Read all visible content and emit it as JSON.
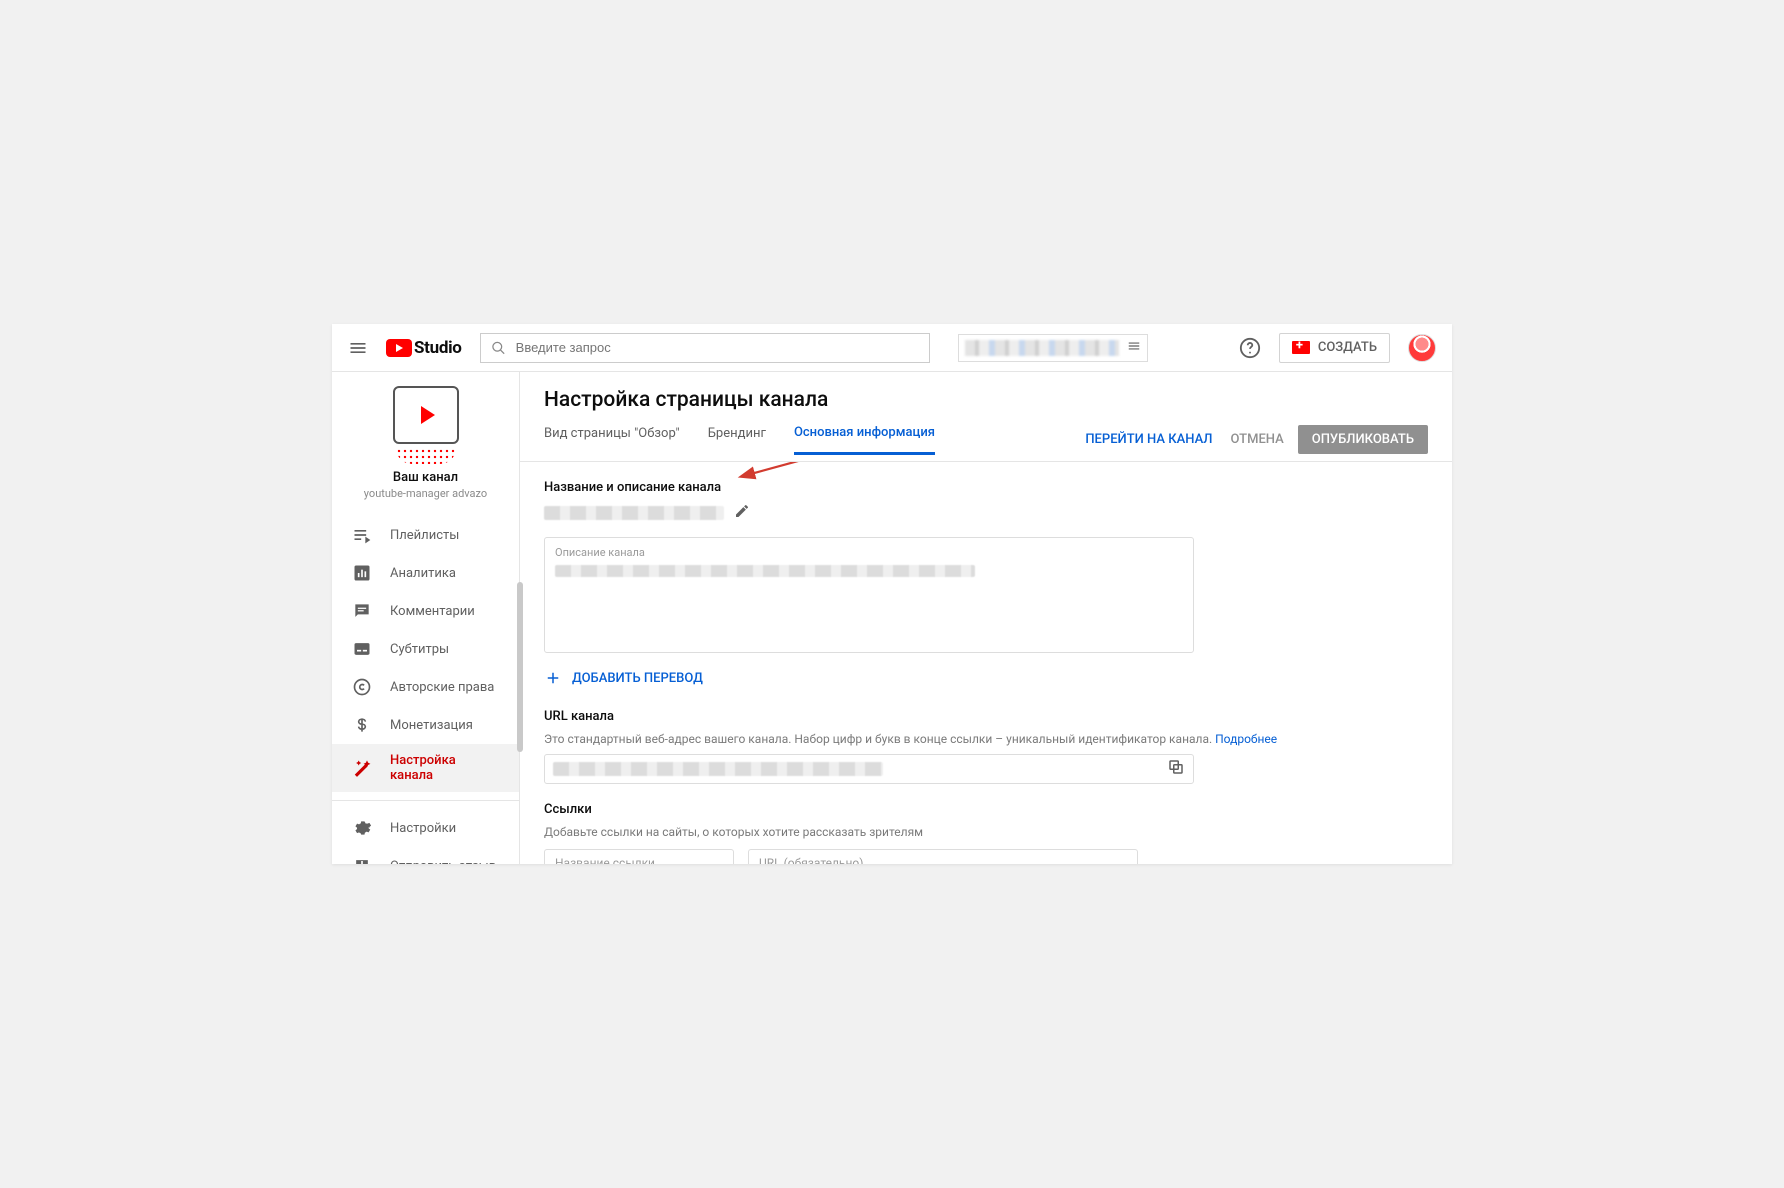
{
  "header": {
    "logo_text": "Studio",
    "search_placeholder": "Введите запрос",
    "create_label": "СОЗДАТЬ"
  },
  "sidebar": {
    "channel_title": "Ваш канал",
    "channel_subtitle": "youtube-manager advazo",
    "items": [
      {
        "icon": "playlist",
        "label": "Плейлисты"
      },
      {
        "icon": "analytics",
        "label": "Аналитика"
      },
      {
        "icon": "comments",
        "label": "Комментарии"
      },
      {
        "icon": "subtitles",
        "label": "Субтитры"
      },
      {
        "icon": "copyright",
        "label": "Авторские права"
      },
      {
        "icon": "monetize",
        "label": "Монетизация"
      },
      {
        "icon": "customize",
        "label": "Настройка канала",
        "active": true
      }
    ],
    "footer": [
      {
        "icon": "settings",
        "label": "Настройки"
      },
      {
        "icon": "feedback",
        "label": "Отправить отзыв"
      }
    ]
  },
  "page": {
    "title": "Настройка страницы канала",
    "tabs": [
      {
        "label": "Вид страницы \"Обзор\""
      },
      {
        "label": "Брендинг"
      },
      {
        "label": "Основная информация",
        "active": true
      }
    ],
    "actions": {
      "view_channel": "ПЕРЕЙТИ НА КАНАЛ",
      "cancel": "ОТМЕНА",
      "publish": "ОПУБЛИКОВАТЬ"
    },
    "name_section_title": "Название и описание канала",
    "description_label": "Описание канала",
    "add_translation": "ДОБАВИТЬ ПЕРЕВОД",
    "url_title": "URL канала",
    "url_hint": "Это стандартный веб-адрес вашего канала. Набор цифр и букв в конце ссылки – уникальный идентификатор канала.",
    "url_more": "Подробнее",
    "links_title": "Ссылки",
    "links_hint": "Добавьте ссылки на сайты, о которых хотите рассказать зрителям",
    "link_name_placeholder": "Название ссылки (обязательно)",
    "link_url_placeholder": "URL (обязательно)"
  }
}
